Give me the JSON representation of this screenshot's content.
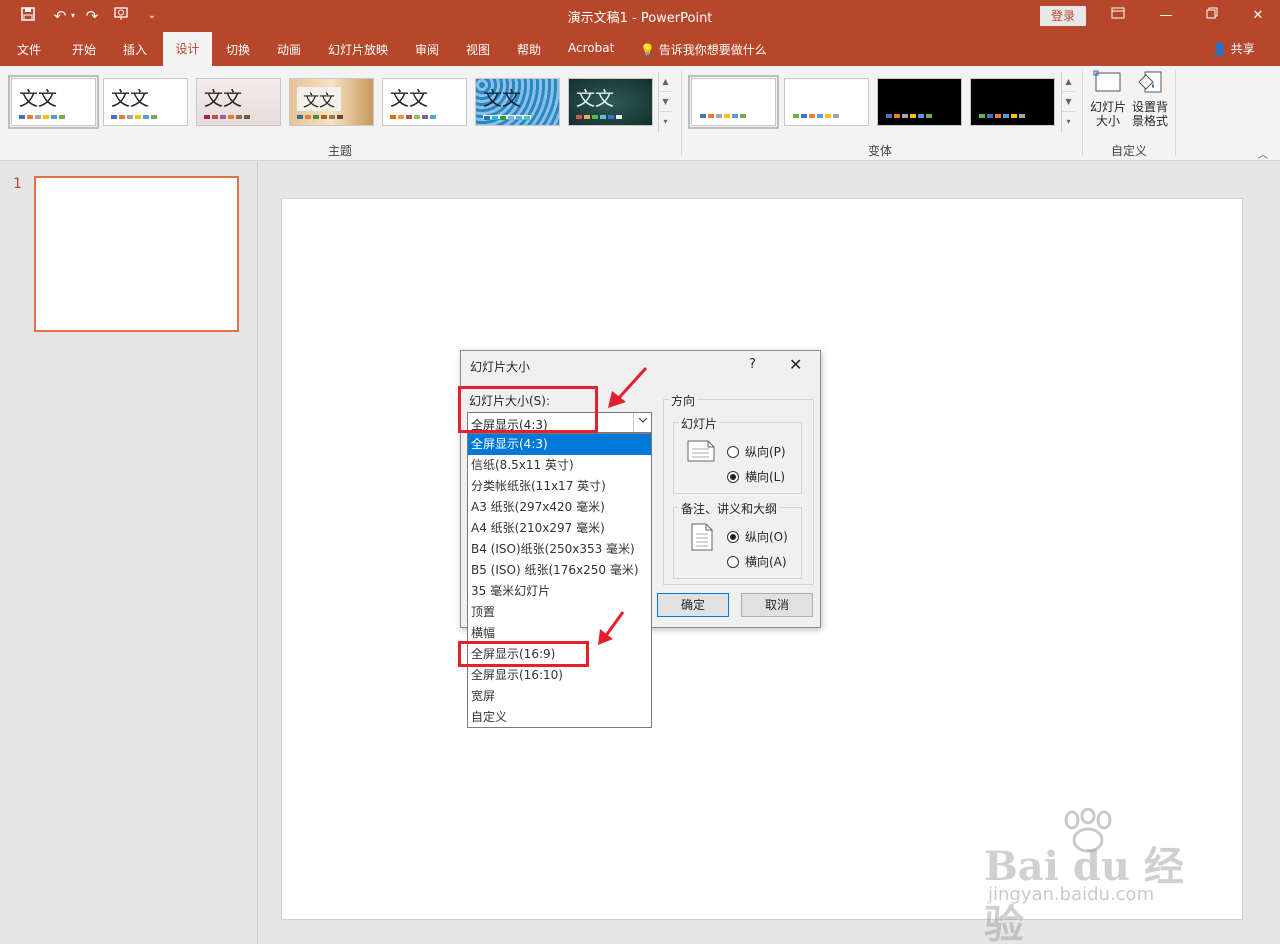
{
  "window": {
    "title": "演示文稿1  -  PowerPoint",
    "login_label": "登录"
  },
  "ribbon": {
    "tabs": [
      "文件",
      "开始",
      "插入",
      "设计",
      "切换",
      "动画",
      "幻灯片放映",
      "审阅",
      "视图",
      "帮助",
      "Acrobat"
    ],
    "active_tab": "设计",
    "tell_me": "告诉我你想要做什么",
    "share_label": "共享",
    "themes_group_label": "主题",
    "variants_group_label": "变体",
    "customize_group_label": "自定义",
    "theme_sample_text": "文文",
    "slide_size_button": "幻灯片大小",
    "background_button": "设置背景格式",
    "colors": {
      "accent": "#b7472a"
    }
  },
  "thumbnails": {
    "slide_number": "1"
  },
  "dialog": {
    "title": "幻灯片大小",
    "help": "?",
    "close": "✕",
    "size_label": "幻灯片大小(S):",
    "size_value": "全屏显示(4:3)",
    "orientation_label": "方向",
    "slides_label": "幻灯片",
    "slides_portrait": "纵向(P)",
    "slides_landscape": "横向(L)",
    "slides_selected": "landscape",
    "notes_label": "备注、讲义和大纲",
    "notes_portrait": "纵向(O)",
    "notes_landscape": "横向(A)",
    "notes_selected": "portrait",
    "ok_label": "确定",
    "cancel_label": "取消"
  },
  "size_options": [
    "全屏显示(4:3)",
    "信纸(8.5x11 英寸)",
    "分类帐纸张(11x17 英寸)",
    "A3 纸张(297x420 毫米)",
    "A4 纸张(210x297 毫米)",
    "B4 (ISO)纸张(250x353 毫米)",
    "B5 (ISO) 纸张(176x250 毫米)",
    "35 毫米幻灯片",
    "顶置",
    "横幅",
    "全屏显示(16:9)",
    "全屏显示(16:10)",
    "宽屏",
    "自定义"
  ],
  "selected_option": "全屏显示(4:3)",
  "watermark": {
    "brand": "Bai du 经验",
    "url": "jingyan.baidu.com"
  }
}
